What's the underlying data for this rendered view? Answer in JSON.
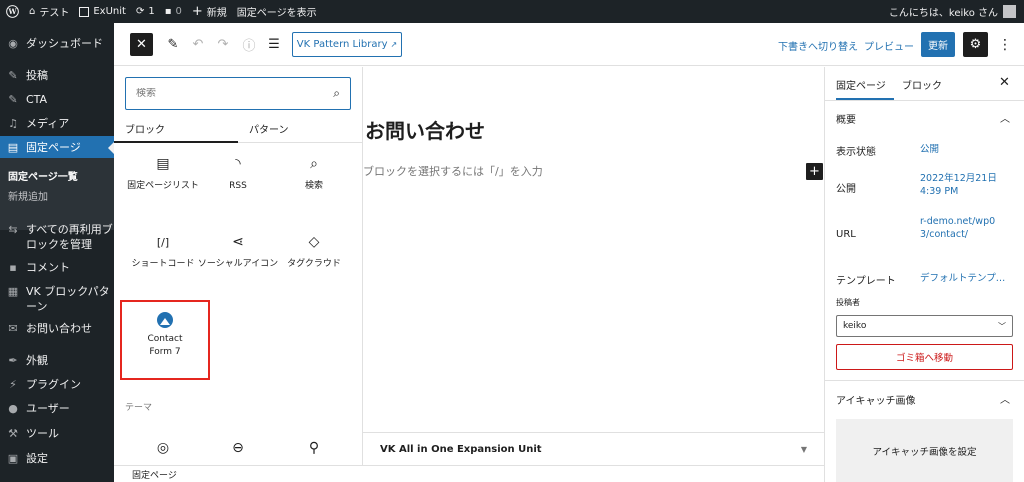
{
  "admin_bar": {
    "site_name": "テスト",
    "exunit": "ExUnit",
    "updates_count": "1",
    "comments_count": "0",
    "new_label": "新規",
    "view_page": "固定ページを表示",
    "greeting": "こんにちは、keiko さん"
  },
  "sidebar": {
    "dashboard": "ダッシュボード",
    "posts": "投稿",
    "cta": "CTA",
    "media": "メディア",
    "pages": "固定ページ",
    "pages_all": "固定ページ一覧",
    "pages_new": "新規追加",
    "reusable": "すべての再利用ブロックを管理",
    "comments": "コメント",
    "vk_patterns": "VK ブロックパターン",
    "contact": "お問い合わせ",
    "appearance": "外観",
    "plugins": "プラグイン",
    "users": "ユーザー",
    "tools": "ツール",
    "settings": "設定"
  },
  "toolbar": {
    "vk_pattern_library": "VK Pattern Library",
    "switch_draft": "下書きへ切り替え",
    "preview": "プレビュー",
    "update": "更新"
  },
  "inserter": {
    "search_placeholder": "検索",
    "tab_blocks": "ブロック",
    "tab_patterns": "パターン",
    "blocks": {
      "page_list": "固定ページリスト",
      "rss": "RSS",
      "search": "検索",
      "shortcode": "ショートコード",
      "social_icons": "ソーシャルアイコン",
      "tag_cloud": "タグクラウド",
      "contact_form_7": "Contact Form 7"
    },
    "theme_category": "テーマ"
  },
  "canvas": {
    "title": "お問い合わせ",
    "placeholder": "ブロックを選択するには「/」を入力",
    "meta_box": "VK All in One Expansion Unit"
  },
  "settings_panel": {
    "tab_page": "固定ページ",
    "tab_block": "ブロック",
    "summary": "概要",
    "visibility_label": "表示状態",
    "visibility_value": "公開",
    "publish_label": "公開",
    "publish_value": "2022年12月21日 4:39 PM",
    "url_label": "URL",
    "url_value": "r-demo.net/wp03/contact/",
    "template_label": "テンプレート",
    "template_value": "デフォルトテンプ…",
    "author_label": "投稿者",
    "author_value": "keiko",
    "trash": "ゴミ箱へ移動",
    "featured_image": "アイキャッチ画像",
    "set_featured": "アイキャッチ画像を設定"
  },
  "footer": {
    "breadcrumb": "固定ページ"
  },
  "colors": {
    "accent": "#2271b1",
    "admin_dark": "#1d2327",
    "danger": "#cc1818",
    "highlight_box": "#e5261f"
  }
}
